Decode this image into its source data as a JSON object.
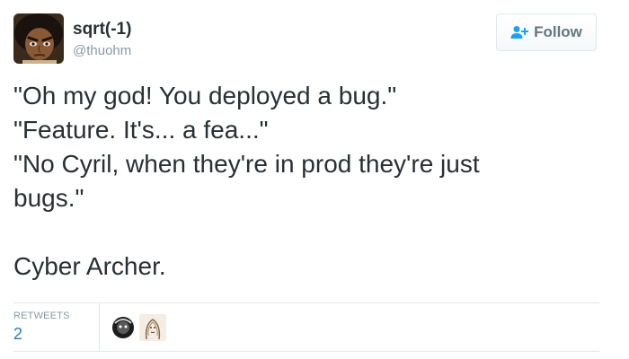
{
  "user": {
    "display_name": "sqrt(-1)",
    "screen_name": "@thuohm",
    "avatar_icon": "avatar-cartoon-boy-icon"
  },
  "follow_button": {
    "label": "Follow",
    "icon": "add-person-icon"
  },
  "tweet": {
    "lines": [
      "\"Oh my god! You deployed a bug.\"",
      "\"Feature. It's... a fea...\"",
      "\"No Cyril, when they're in prod they're just",
      "bugs.\"",
      "",
      "Cyber Archer."
    ]
  },
  "stats": {
    "retweets_label": "RETWEETS",
    "retweets_count": "2"
  },
  "retweeters": [
    {
      "icon": "retweeter-avatar-dark-icon"
    },
    {
      "icon": "retweeter-avatar-sketch-icon"
    }
  ],
  "colors": {
    "text": "#292f33",
    "muted": "#8899a6",
    "link": "#2b7bb9",
    "border": "#e1e8ed"
  }
}
